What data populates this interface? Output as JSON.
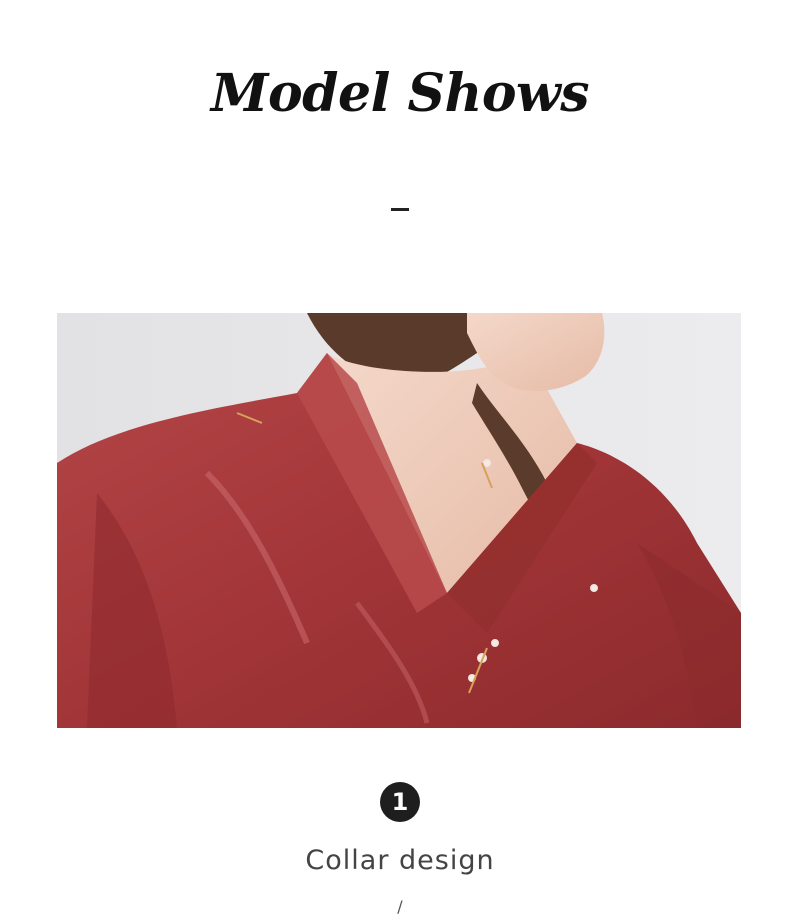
{
  "header": {
    "title": "Model Shows"
  },
  "feature": {
    "number": "1",
    "label": "Collar design",
    "separator": "/"
  },
  "colors": {
    "robe": "#a83b3c",
    "background": "#ffffff",
    "text": "#444444",
    "badge": "#1e1e1e"
  }
}
